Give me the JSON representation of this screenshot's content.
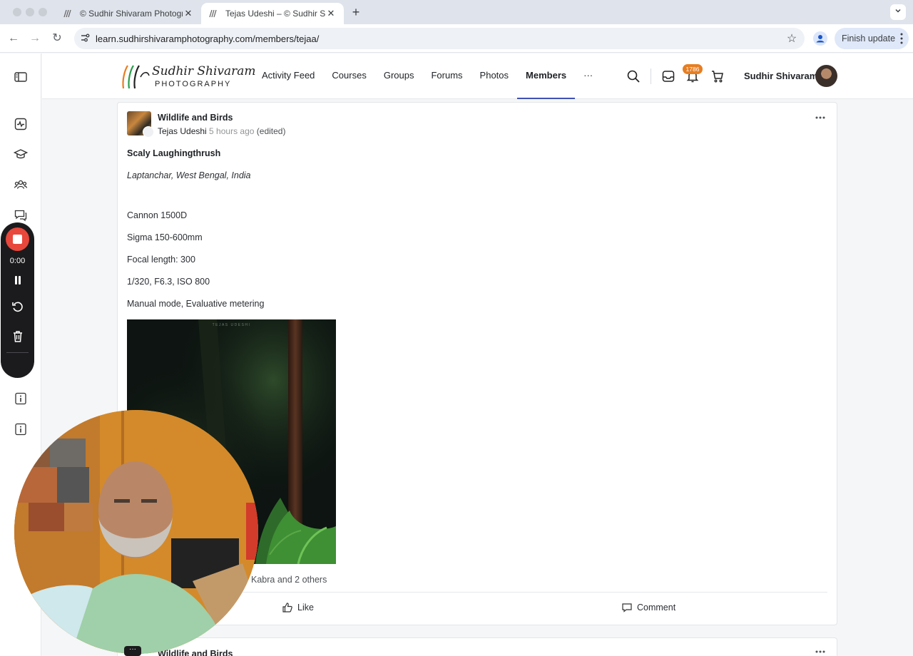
{
  "browser": {
    "tabs": [
      {
        "title": "© Sudhir Shivaram Photograp",
        "active": false
      },
      {
        "title": "Tejas Udeshi – © Sudhir Shiva",
        "active": true
      }
    ],
    "url": "learn.sudhirshivaramphotography.com/members/tejaa/",
    "update_button": "Finish update"
  },
  "recorder": {
    "time": "0:00"
  },
  "site": {
    "logo": {
      "line1": "Sudhir Shivaram",
      "line2": "PHOTOGRAPHY"
    },
    "nav": [
      {
        "label": "Activity Feed",
        "active": false
      },
      {
        "label": "Courses",
        "active": false
      },
      {
        "label": "Groups",
        "active": false
      },
      {
        "label": "Forums",
        "active": false
      },
      {
        "label": "Photos",
        "active": false
      },
      {
        "label": "Members",
        "active": true
      },
      {
        "label": "···",
        "active": false
      }
    ],
    "notification_count": "1786",
    "user_name": "Sudhir Shivaram"
  },
  "post": {
    "group": "Wildlife and Birds",
    "author": "Tejas Udeshi",
    "time": "5 hours ago",
    "edited": "(edited)",
    "title": "Scaly Laughingthrush",
    "location": "Laptanchar, West Bengal, India",
    "lines": [
      "Cannon 1500D",
      "Sigma 150-600mm",
      "Focal length: 300",
      "1/320, F6.3, ISO 800",
      "Manual mode, Evaluative metering"
    ],
    "photo_watermark": "TEJAS UDESHI",
    "likes_text": "Kabra and 2 others",
    "like_label": "Like",
    "comment_label": "Comment"
  },
  "next_post": {
    "group": "Wildlife and Birds"
  },
  "colors": {
    "accent": "#3f51b5",
    "badge": "#e67e22",
    "record": "#e8473b"
  }
}
